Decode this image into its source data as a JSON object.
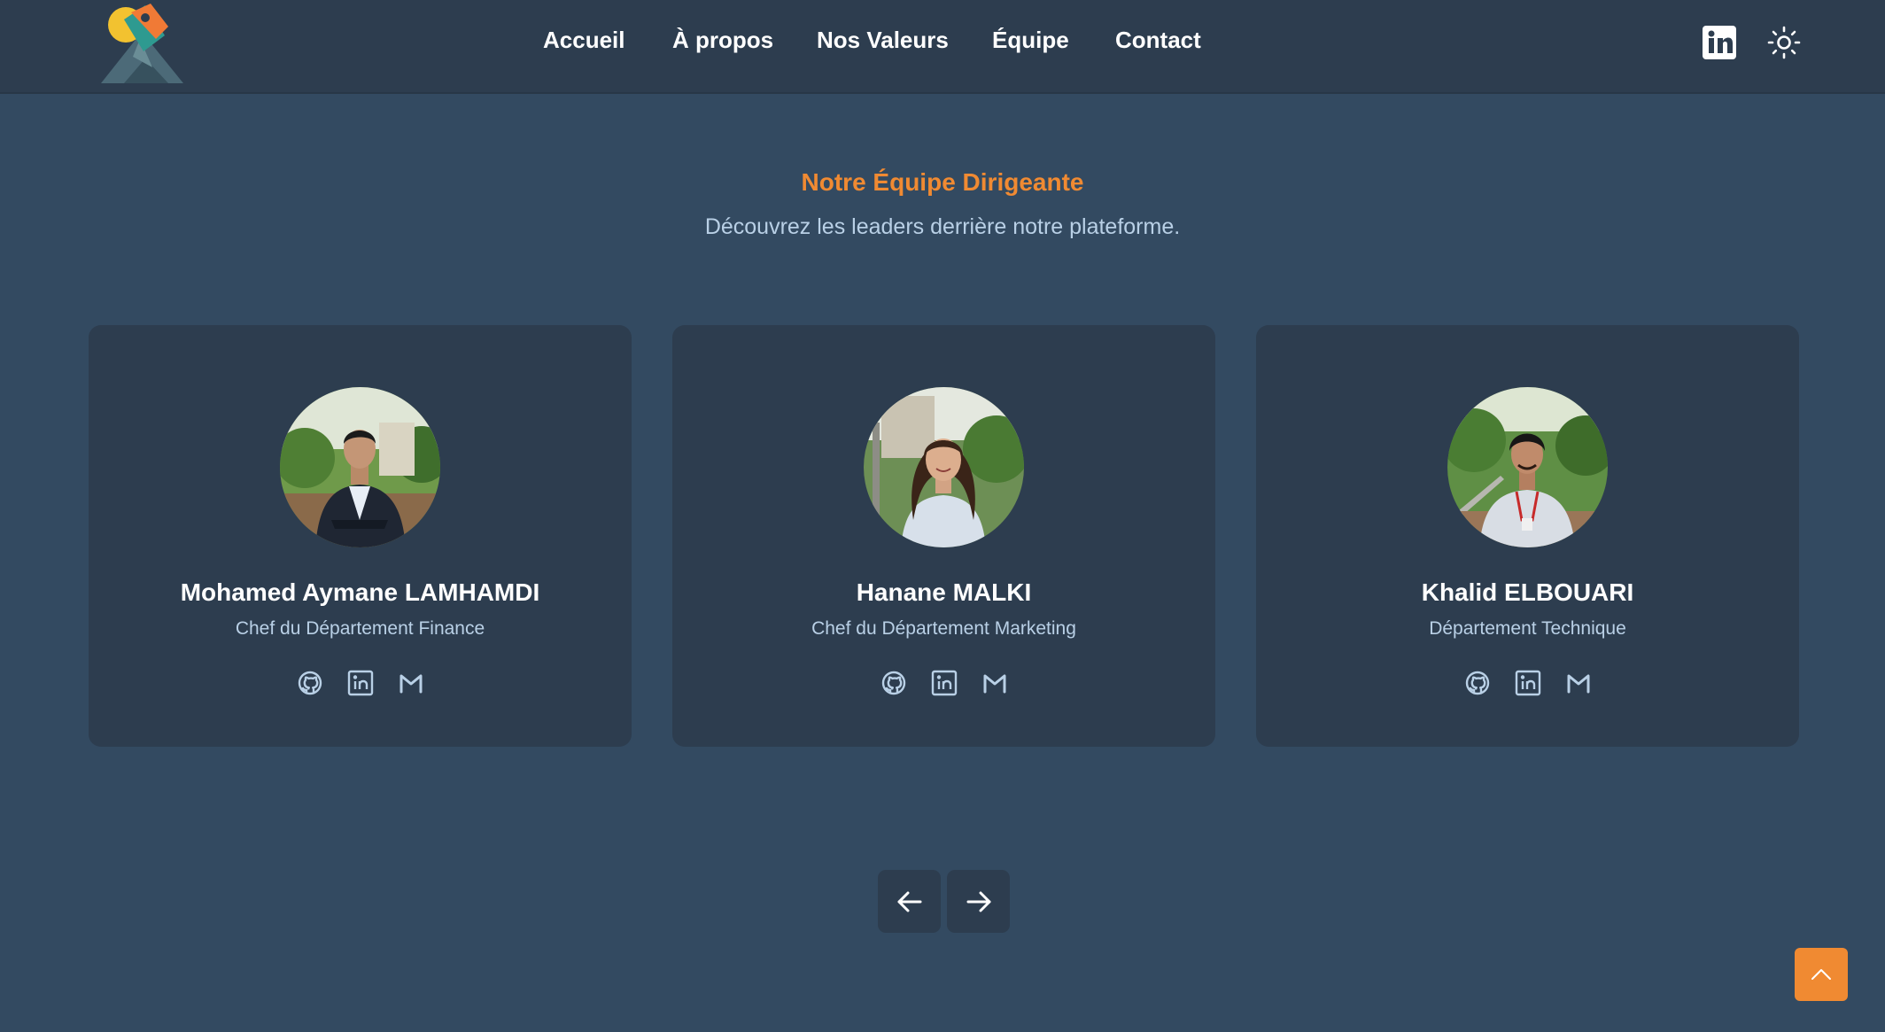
{
  "header": {
    "nav": [
      {
        "label": "Accueil"
      },
      {
        "label": "À propos"
      },
      {
        "label": "Nos Valeurs"
      },
      {
        "label": "Équipe"
      },
      {
        "label": "Contact"
      }
    ],
    "icons": {
      "linkedin": "linkedin-icon",
      "theme": "sun-icon"
    }
  },
  "team": {
    "title": "Notre Équipe Dirigeante",
    "subtitle": "Découvrez les leaders derrière notre plateforme.",
    "members": [
      {
        "name": "Mohamed Aymane LAMHAMDI",
        "role": "Chef du Département Finance"
      },
      {
        "name": "Hanane MALKI",
        "role": "Chef du Département Marketing"
      },
      {
        "name": "Khalid ELBOUARI",
        "role": "Département Technique"
      }
    ],
    "social_icons": [
      "github-icon",
      "linkedin-icon",
      "gmail-icon"
    ]
  },
  "carousel": {
    "prev_icon": "arrow-left-icon",
    "next_icon": "arrow-right-icon"
  },
  "scroll_top_icon": "chevron-up-icon",
  "colors": {
    "page_bg": "#334a61",
    "surface": "#2d3d4f",
    "accent": "#f08a32",
    "muted_text": "#b9d0e6"
  }
}
